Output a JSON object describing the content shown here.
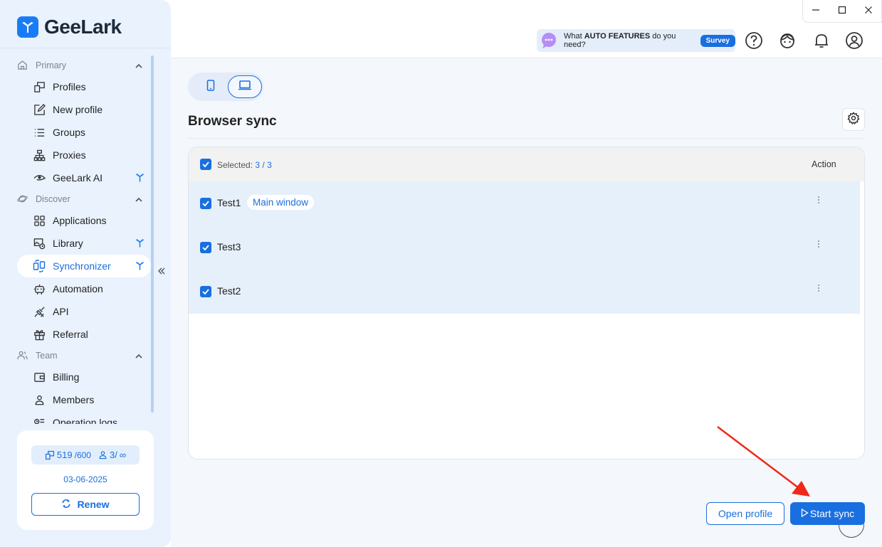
{
  "app": {
    "name": "GeeLark"
  },
  "sidebar": {
    "sections": [
      {
        "label": "Primary",
        "icon": "home-icon"
      },
      {
        "label": "Discover",
        "icon": "planet-icon"
      },
      {
        "label": "Team",
        "icon": "team-icon"
      }
    ],
    "items": [
      {
        "label": "Profiles",
        "icon": "profiles-icon"
      },
      {
        "label": "New profile",
        "icon": "edit-icon"
      },
      {
        "label": "Groups",
        "icon": "list-icon"
      },
      {
        "label": "Proxies",
        "icon": "network-icon"
      },
      {
        "label": "GeeLark AI",
        "icon": "eye-icon"
      },
      {
        "label": "Applications",
        "icon": "grid-icon"
      },
      {
        "label": "Library",
        "icon": "image-icon"
      },
      {
        "label": "Synchronizer",
        "icon": "sync-icon",
        "active": true
      },
      {
        "label": "Automation",
        "icon": "robot-icon"
      },
      {
        "label": "API",
        "icon": "api-icon"
      },
      {
        "label": "Referral",
        "icon": "gift-icon"
      },
      {
        "label": "Billing",
        "icon": "wallet-icon"
      },
      {
        "label": "Members",
        "icon": "person-icon"
      },
      {
        "label": "Operation logs",
        "icon": "log-icon"
      }
    ],
    "account": {
      "profiles_used": "519",
      "profiles_total": "/600",
      "members_used": "3/",
      "members_total": "∞",
      "date": "03-06-2025",
      "renew_label": "Renew"
    }
  },
  "header": {
    "survey_prefix": "What ",
    "survey_bold": "AUTO FEATURES",
    "survey_suffix": " do you need?",
    "survey_button": "Survey"
  },
  "main": {
    "title": "Browser sync",
    "table": {
      "selected_label": "Selected:",
      "selected_count": "3 / 3",
      "action_header": "Action",
      "rows": [
        {
          "name": "Test1",
          "tag": "Main window"
        },
        {
          "name": "Test3",
          "tag": ""
        },
        {
          "name": "Test2",
          "tag": ""
        }
      ]
    },
    "open_profile_label": "Open profile",
    "start_sync_label": "Start sync"
  },
  "colors": {
    "accent": "#1a6fe0",
    "sidebar_bg": "#e9f2fd",
    "row_selected": "#e6f0fb",
    "annotation_arrow": "#f02818"
  }
}
